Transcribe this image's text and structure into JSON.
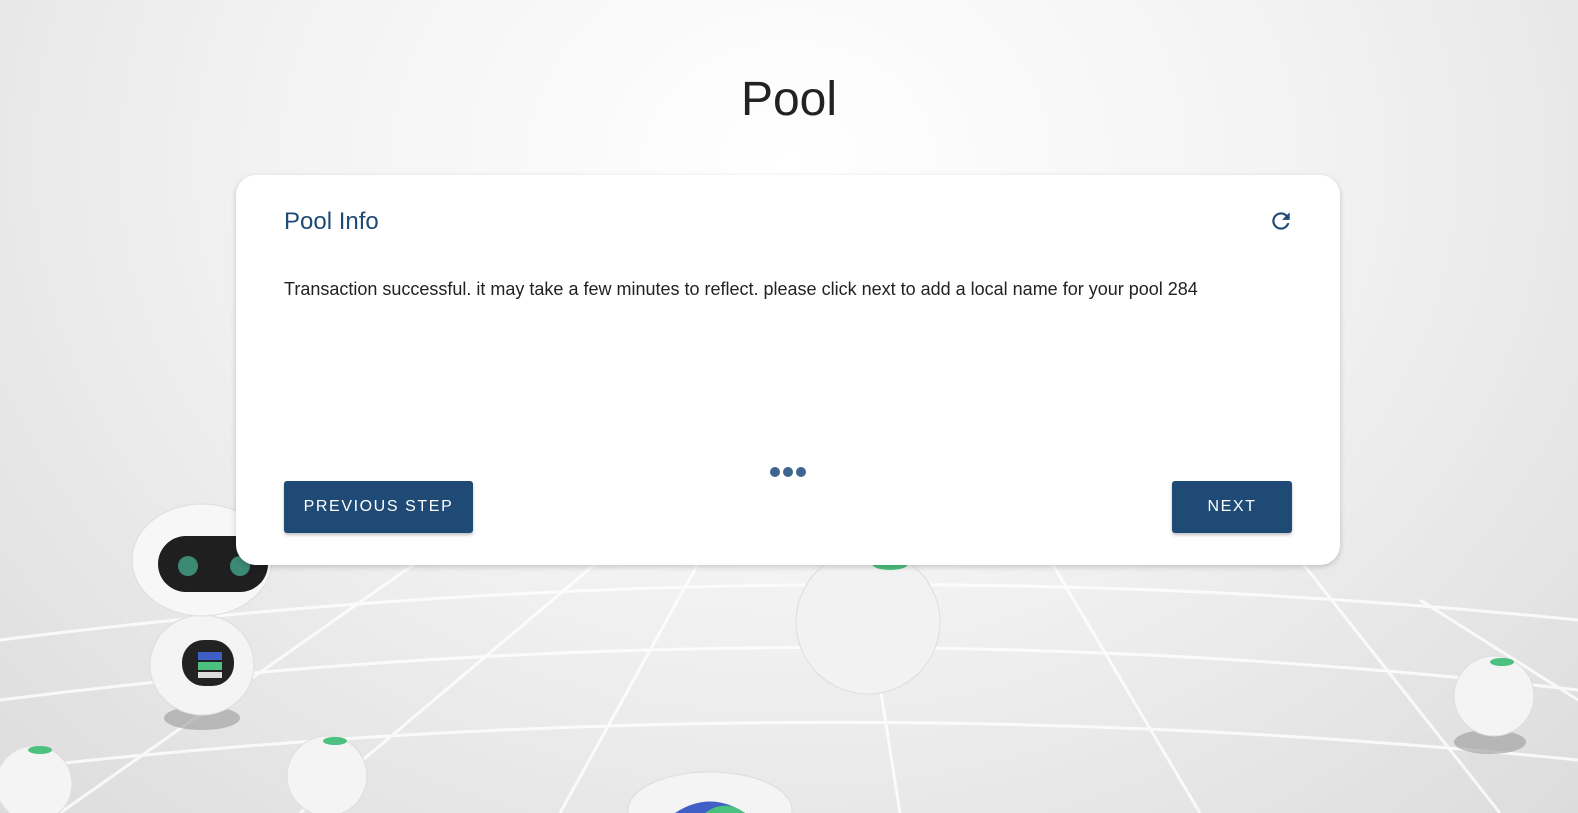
{
  "page": {
    "title": "Pool"
  },
  "card": {
    "title": "Pool Info",
    "message": "Transaction successful. it may take a few minutes to reflect. please click next to add a local name for your pool 284",
    "refresh_icon": "refresh-icon",
    "loading_icon": "loading-dots-icon"
  },
  "buttons": {
    "previous_label": "PREVIOUS STEP",
    "next_label": "NEXT"
  },
  "colors": {
    "accent": "#1f4a75",
    "title_text": "#222222",
    "card_bg": "#ffffff"
  }
}
